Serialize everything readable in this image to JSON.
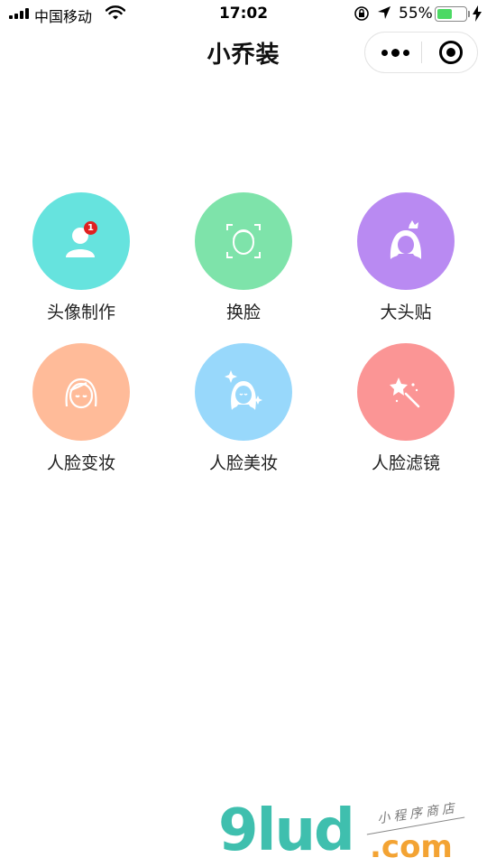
{
  "status_bar": {
    "carrier": "中国移动",
    "time": "17:02",
    "battery_percent": "55%",
    "battery_level": 0.55
  },
  "nav": {
    "title": "小乔装"
  },
  "tiles": [
    {
      "label": "头像制作",
      "color": "#66e3de",
      "icon": "avatar-icon",
      "badge": "1"
    },
    {
      "label": "换脸",
      "color": "#7ee3aa",
      "icon": "face-scan-icon"
    },
    {
      "label": "大头贴",
      "color": "#b98af2",
      "icon": "princess-icon"
    },
    {
      "label": "人脸变妆",
      "color": "#ffbb99",
      "icon": "face-makeover-icon"
    },
    {
      "label": "人脸美妆",
      "color": "#98d8fb",
      "icon": "sparkle-face-icon"
    },
    {
      "label": "人脸滤镜",
      "color": "#fb9595",
      "icon": "magic-wand-icon"
    }
  ],
  "watermark": {
    "logo": "9lud",
    "domain": ".com",
    "tagline": "小程序商店"
  }
}
